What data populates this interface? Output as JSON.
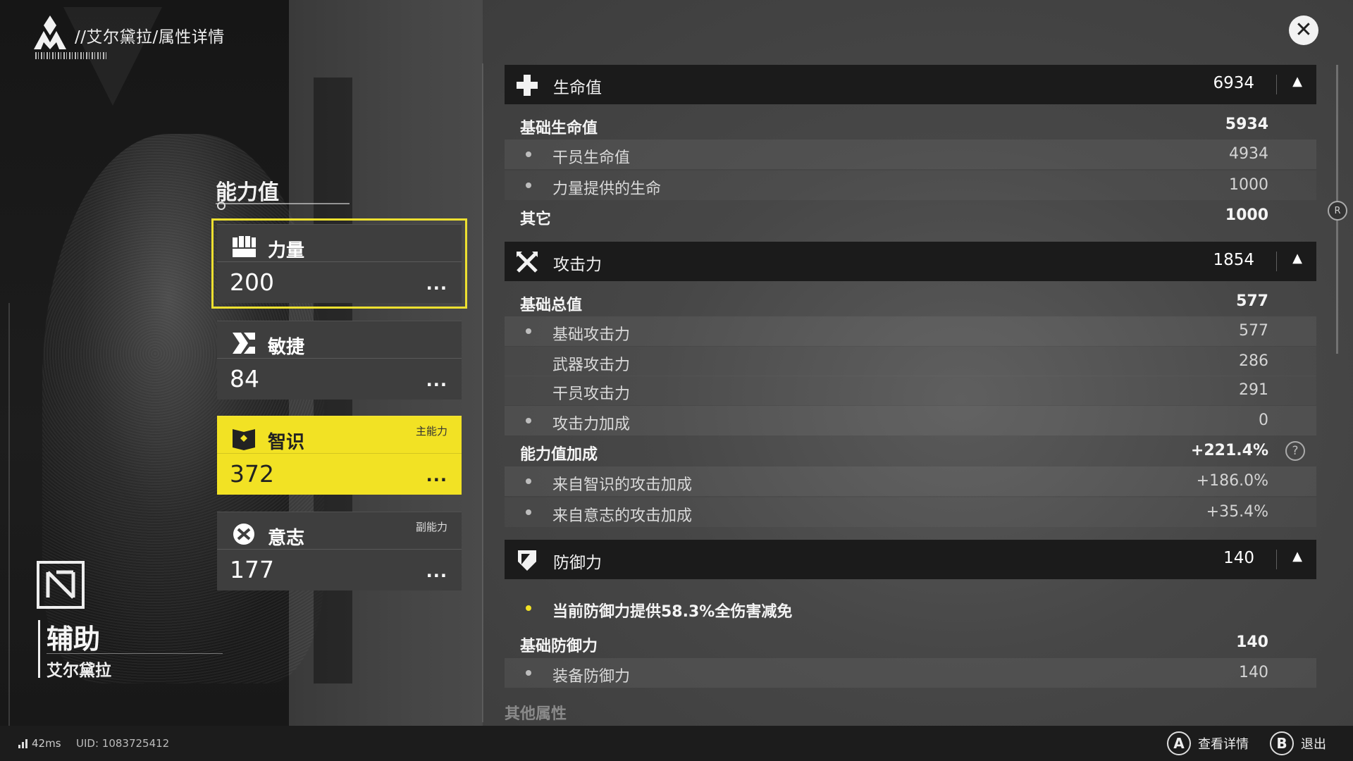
{
  "header": {
    "title": "//艾尔黛拉/属性详情"
  },
  "ability": {
    "title": "能力值",
    "cards": [
      {
        "name": "力量",
        "value": "200",
        "tag": "",
        "more": "...",
        "icon": "fist-icon"
      },
      {
        "name": "敏捷",
        "value": "84",
        "tag": "",
        "more": "...",
        "icon": "agility-icon"
      },
      {
        "name": "智识",
        "value": "372",
        "tag": "主能力",
        "more": "...",
        "icon": "intellect-icon"
      },
      {
        "name": "意志",
        "value": "177",
        "tag": "副能力",
        "more": "...",
        "icon": "will-icon"
      }
    ]
  },
  "role": {
    "label": "辅助",
    "name": "艾尔黛拉"
  },
  "sections": {
    "hp": {
      "name": "生命值",
      "value": "6934",
      "caret": "▲",
      "rows": [
        {
          "label": "基础生命值",
          "value": "5934"
        },
        {
          "label": "干员生命值",
          "value": "4934"
        },
        {
          "label": "力量提供的生命",
          "value": "1000"
        },
        {
          "label": "其它",
          "value": "1000"
        }
      ]
    },
    "atk": {
      "name": "攻击力",
      "value": "1854",
      "caret": "▲",
      "rows": [
        {
          "label": "基础总值",
          "value": "577"
        },
        {
          "label": "基础攻击力",
          "value": "577"
        },
        {
          "label": "武器攻击力",
          "value": "286"
        },
        {
          "label": "干员攻击力",
          "value": "291"
        },
        {
          "label": "攻击力加成",
          "value": "0"
        },
        {
          "label": "能力值加成",
          "value": "+221.4%",
          "help": "?"
        },
        {
          "label": "来自智识的攻击加成",
          "value": "+186.0%"
        },
        {
          "label": "来自意志的攻击加成",
          "value": "+35.4%"
        }
      ]
    },
    "def": {
      "name": "防御力",
      "value": "140",
      "caret": "▲",
      "note": "当前防御力提供58.3%全伤害减免",
      "rows": [
        {
          "label": "基础防御力",
          "value": "140"
        },
        {
          "label": "装备防御力",
          "value": "140"
        }
      ]
    },
    "other_title": "其他属性"
  },
  "footer": {
    "ping": "42ms",
    "uid": "UID: 1083725412",
    "actions": [
      {
        "button": "A",
        "label": "查看详情"
      },
      {
        "button": "B",
        "label": "退出"
      }
    ]
  },
  "scroll_indicator": "R",
  "colors": {
    "accent_yellow": "#f2e224",
    "panel_dark": "#1b1b1b",
    "card_gray": "#3e3e3e"
  }
}
